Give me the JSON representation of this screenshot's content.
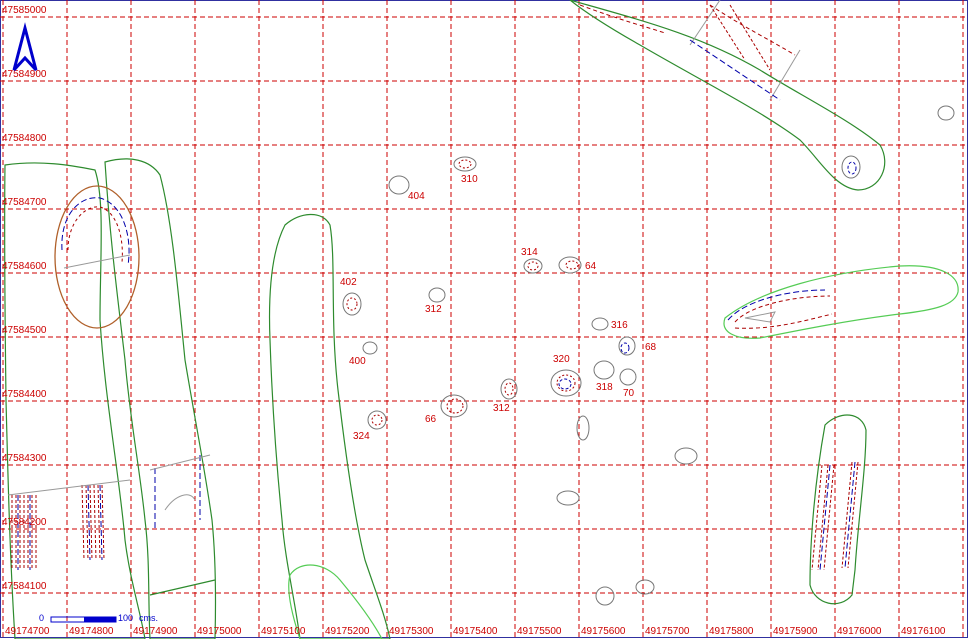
{
  "map": {
    "grid_color": "#cc0000",
    "outline_green": "#2e8b2e",
    "light_green": "#55cc55",
    "brown": "#b0602a",
    "north_arrow_color": "#0000cc",
    "x_labels": [
      "49174700",
      "49174800",
      "49174900",
      "49175000",
      "49175100",
      "49175200",
      "49175300",
      "49175400",
      "49175500",
      "49175600",
      "49175700",
      "49175800",
      "49175900",
      "49176000",
      "49176100"
    ],
    "y_labels": [
      "47585000",
      "47584900",
      "47584800",
      "47584700",
      "47584600",
      "47584500",
      "47584400",
      "47584300",
      "47584200",
      "47584100"
    ],
    "scale": {
      "zero": "0",
      "max": "100",
      "unit": "cms."
    },
    "features": [
      "310",
      "404",
      "314",
      "64",
      "402",
      "312",
      "316",
      "68",
      "400",
      "320",
      "318",
      "70",
      "312",
      "66",
      "324"
    ]
  }
}
